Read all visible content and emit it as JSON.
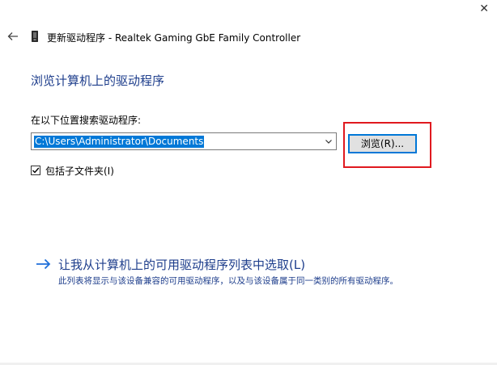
{
  "window": {
    "close_glyph": "✕",
    "title": "更新驱动程序 - Realtek Gaming GbE Family Controller"
  },
  "main": {
    "heading": "浏览计算机上的驱动程序",
    "search_label": "在以下位置搜索驱动程序:",
    "path_value": "C:\\Users\\Administrator\\Documents",
    "browse_label": "浏览(R)...",
    "include_subfolders_label": "包括子文件夹(I)",
    "include_subfolders_checked": true
  },
  "pick_option": {
    "arrow_glyph": "→",
    "link_text": "让我从计算机上的可用驱动程序列表中选取(L)",
    "description": "此列表将显示与该设备兼容的可用驱动程序，以及与该设备属于同一类别的所有驱动程序。"
  },
  "colors": {
    "accent_blue": "#0078d7",
    "link_blue": "#1e3e8c",
    "highlight_red": "#e0191f"
  },
  "icons": {
    "back": "back-arrow-icon",
    "device": "network-device-icon",
    "close": "close-icon",
    "chevron": "chevron-down-icon",
    "check": "checkmark-icon"
  }
}
